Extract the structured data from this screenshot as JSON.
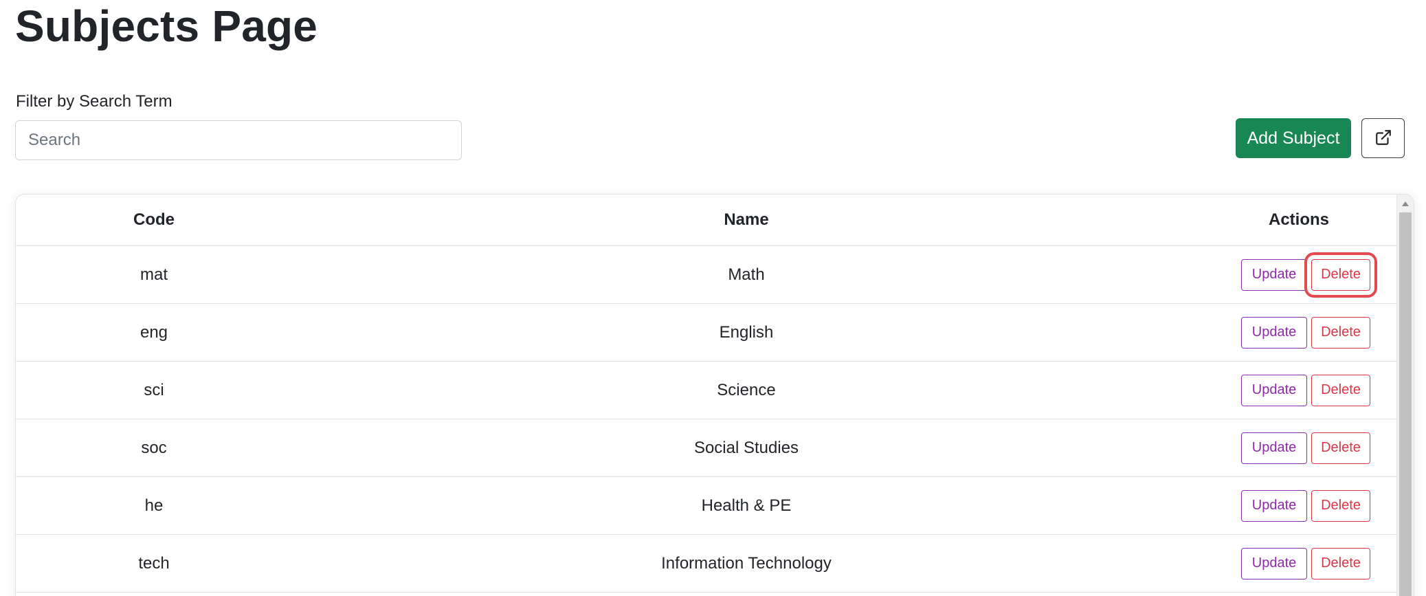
{
  "page": {
    "title": "Subjects Page"
  },
  "filter": {
    "label": "Filter by Search Term",
    "placeholder": "Search",
    "value": ""
  },
  "toolbar": {
    "add_label": "Add Subject",
    "export_icon": "external-link-icon"
  },
  "table": {
    "headers": {
      "code": "Code",
      "name": "Name",
      "actions": "Actions"
    },
    "rows": [
      {
        "code": "mat",
        "name": "Math",
        "update": "Update",
        "delete": "Delete"
      },
      {
        "code": "eng",
        "name": "English",
        "update": "Update",
        "delete": "Delete"
      },
      {
        "code": "sci",
        "name": "Science",
        "update": "Update",
        "delete": "Delete"
      },
      {
        "code": "soc",
        "name": "Social Studies",
        "update": "Update",
        "delete": "Delete"
      },
      {
        "code": "he",
        "name": "Health & PE",
        "update": "Update",
        "delete": "Delete"
      },
      {
        "code": "tech",
        "name": "Information Technology",
        "update": "Update",
        "delete": "Delete"
      }
    ]
  },
  "colors": {
    "add_button": "#198754",
    "update_outline": "#8a2aa8",
    "delete_outline": "#dc3545",
    "highlight": "#e5484d"
  }
}
